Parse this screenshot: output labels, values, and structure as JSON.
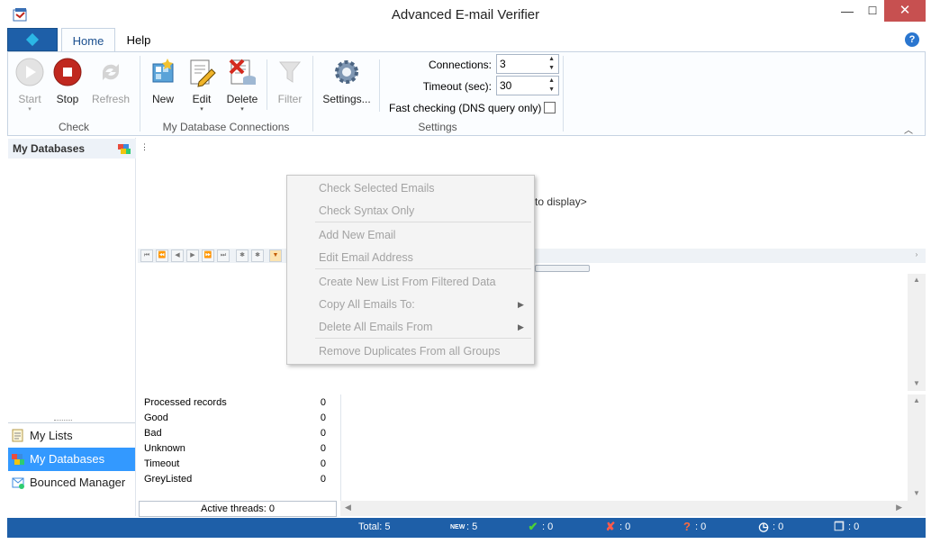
{
  "window": {
    "title": "Advanced E-mail Verifier",
    "min": "—",
    "max": "☐",
    "close": "✕"
  },
  "tabs": {
    "home": "Home",
    "help": "Help"
  },
  "ribbon": {
    "check": {
      "start": "Start",
      "stop": "Stop",
      "refresh": "Refresh",
      "group": "Check"
    },
    "connections": {
      "new": "New",
      "edit": "Edit",
      "delete": "Delete",
      "filter": "Filter",
      "group": "My Database Connections"
    },
    "settings": {
      "settings_btn": "Settings...",
      "connections_label": "Connections:",
      "connections_value": "3",
      "timeout_label": "Timeout (sec):",
      "timeout_value": "30",
      "fast_check_label": "Fast checking (DNS query only)",
      "group": "Settings"
    }
  },
  "leftpane": {
    "header": "My Databases",
    "nav": [
      {
        "label": "My Lists"
      },
      {
        "label": "My Databases"
      },
      {
        "label": "Bounced Manager"
      }
    ]
  },
  "grid": {
    "empty_text": "to display>"
  },
  "context_menu": {
    "items": [
      "Check Selected Emails",
      "Check Syntax Only",
      "Add New Email",
      "Edit Email Address",
      "Create New List From Filtered Data",
      "Copy All Emails To:",
      "Delete All Emails From",
      "Remove Duplicates From all Groups"
    ]
  },
  "stats": [
    {
      "label": "Processed records",
      "value": "0"
    },
    {
      "label": "Good",
      "value": "0"
    },
    {
      "label": "Bad",
      "value": "0"
    },
    {
      "label": "Unknown",
      "value": "0"
    },
    {
      "label": "Timeout",
      "value": "0"
    },
    {
      "label": "GreyListed",
      "value": "0"
    }
  ],
  "threads": "Active threads: 0",
  "statusbar": {
    "total": "Total: 5",
    "new_badge": "NEW",
    "new_count": ": 5",
    "good": ": 0",
    "bad": ": 0",
    "unknown": ": 0",
    "timeout": ": 0",
    "grey": ": 0"
  },
  "colors": {
    "accent": "#1e5fa8",
    "selection": "#3399ff",
    "stop_red": "#c0281f"
  }
}
